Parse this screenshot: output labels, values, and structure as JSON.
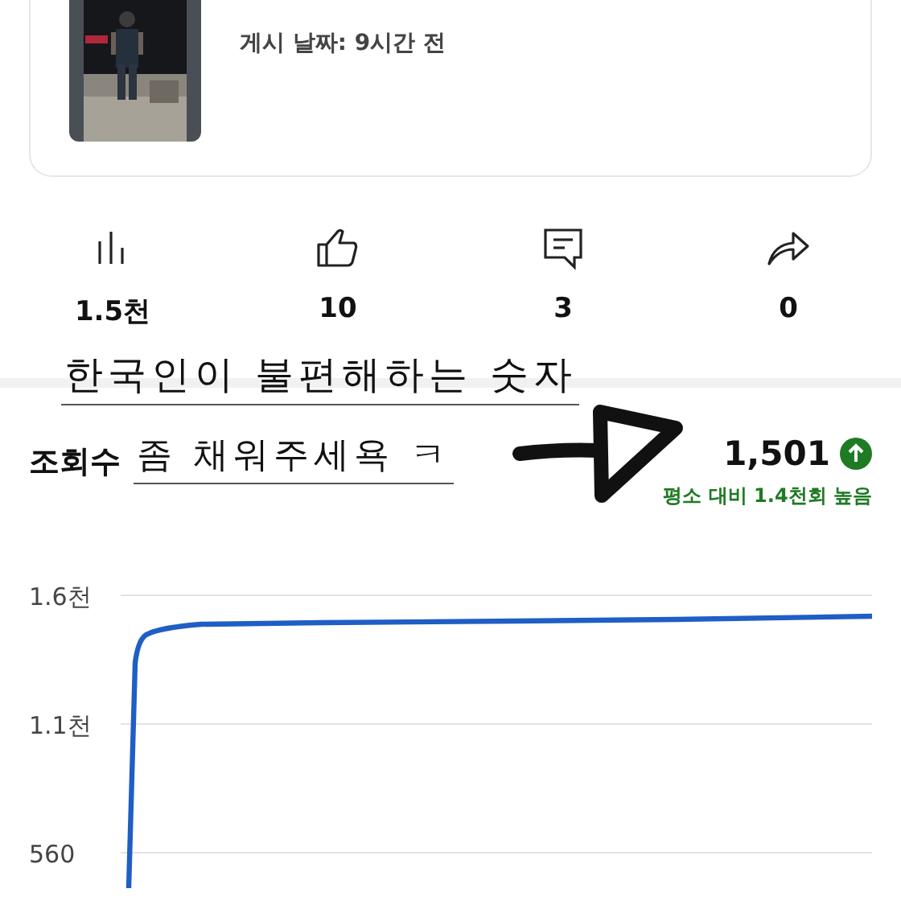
{
  "video": {
    "posted": "게시 날짜: 9시간 전"
  },
  "stats": [
    {
      "kind": "views",
      "value": "1.5천"
    },
    {
      "kind": "likes",
      "value": "10"
    },
    {
      "kind": "comments",
      "value": "3"
    },
    {
      "kind": "shares",
      "value": "0"
    }
  ],
  "annotation": {
    "line1": "한국인이 불편해하는 숫자",
    "line2": "좀 채워주세욕 ㅋ"
  },
  "views": {
    "label": "조회수",
    "total": "1,501",
    "comparison": "평소 대비 1.4천회 높음"
  },
  "chart": {
    "y_labels": [
      "1.6천",
      "1.1천",
      "560"
    ]
  }
}
